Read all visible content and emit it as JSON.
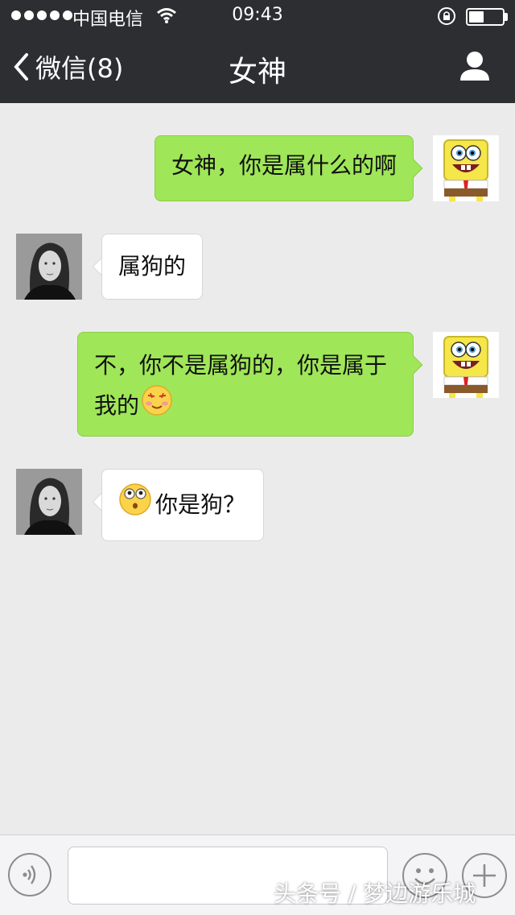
{
  "status_bar": {
    "carrier": "中国电信",
    "time": "09:43",
    "battery_level": 0.45
  },
  "nav": {
    "back_label": "微信(8)",
    "title": "女神",
    "back_icon": "chevron-left-icon",
    "profile_icon": "person-icon"
  },
  "messages": [
    {
      "side": "me",
      "text": "女神，你是属什么的啊",
      "avatar": "spongebob-avatar"
    },
    {
      "side": "them",
      "text": "属狗的",
      "avatar": "woman-avatar"
    },
    {
      "side": "me",
      "text_line1": "不，你不是属狗的，你是属于",
      "text_line2": "我的",
      "emoji": "heart-eyes-emoji",
      "avatar": "spongebob-avatar"
    },
    {
      "side": "them",
      "text": "你是狗？",
      "emoji": "surprised-emoji",
      "avatar": "woman-avatar"
    }
  ],
  "input_bar": {
    "voice_icon": "voice-icon",
    "emoji_icon": "smiley-icon",
    "plus_icon": "plus-icon",
    "input_value": ""
  },
  "watermark": "头条号 / 梦边游乐城",
  "colors": {
    "header_bg": "#2d2e32",
    "chat_bg": "#ebebeb",
    "my_bubble": "#9fe658",
    "their_bubble": "#ffffff"
  }
}
